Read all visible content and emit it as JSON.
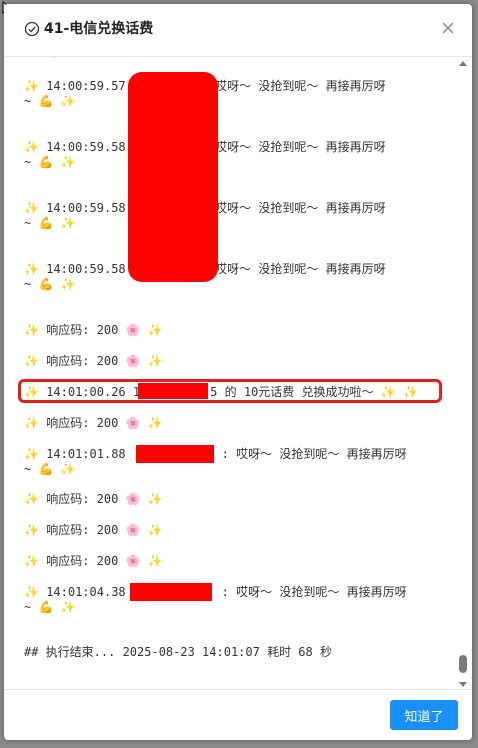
{
  "dialog": {
    "title": "41-电信兑换话费",
    "ok_label": "知道了"
  },
  "icons": {
    "sparkle": "✨",
    "muscle": "💪",
    "flower": "🌸",
    "title_icon": "check-circle-icon",
    "close_icon": "close-icon"
  },
  "log": {
    "top_partial": "~ 💪 ✨",
    "entries": [
      {
        "time": "14:00:59.57",
        "text": ": 哎呀～ 没抢到呢～ 再接再厉呀",
        "wrap": "~ 💪 ✨"
      },
      {
        "time": "14:00:59.58",
        "text": ": 哎呀～ 没抢到呢～ 再接再厉呀",
        "wrap": "~ 💪 ✨"
      },
      {
        "time": "14:00:59.58",
        "text": ": 哎呀～ 没抢到呢～ 再接再厉呀",
        "wrap": "~ 💪 ✨"
      },
      {
        "time": "14:00:59.58",
        "text": ": 哎呀～ 没抢到呢～ 再接再厉呀",
        "wrap": "~ 💪 ✨"
      }
    ],
    "response_label": "响应码:",
    "response_code": "200",
    "success_time": "14:01:00.26",
    "success_prefix": "1",
    "success_suffix": "5",
    "success_text": "的 10元话费 兑换成功啦～",
    "late_time_1": "14:01:01.88",
    "late_time_2": "14:01:04.38",
    "fail_text": ": 哎呀～ 没抢到呢～ 再接再厉呀",
    "wrap_text": "~ 💪 ✨",
    "end_line": "## 执行结束... 2025-08-23 14:01:07  耗时 68 秒"
  },
  "colors": {
    "accent": "#1890ff",
    "redaction": "#ff0000",
    "highlight": "#e02020"
  }
}
